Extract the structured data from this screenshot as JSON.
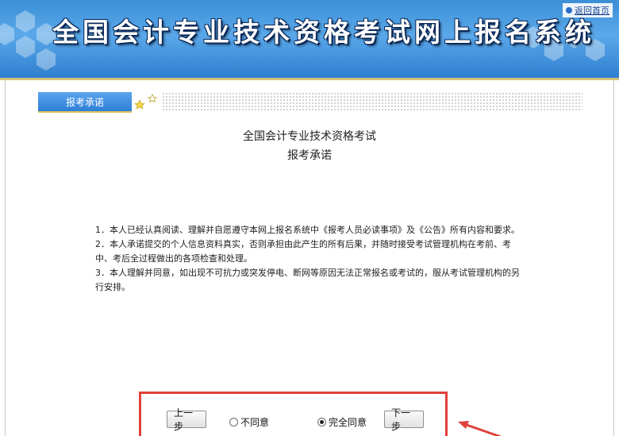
{
  "header": {
    "title": "全国会计专业技术资格考试网上报名系统",
    "home_link": "返回首页"
  },
  "tab": {
    "label": "报考承诺"
  },
  "document": {
    "title_line1": "全国会计专业技术资格考试",
    "title_line2": "报考承诺",
    "terms": [
      "1．本人已经认真阅读、理解并自愿遵守本网上报名系统中《报考人员必读事项》及《公告》所有内容和要求。",
      "2．本人承诺提交的个人信息资料真实，否则承担由此产生的所有后果，并随时接受考试管理机构在考前、考中、考后全过程做出的各项检查和处理。",
      "3．本人理解并同意，如出现不可抗力或突发停电、断网等原因无法正常报名或考试的，服从考试管理机构的另行安排。"
    ]
  },
  "actions": {
    "prev_label": "上一步",
    "disagree_label": "不同意",
    "agree_label": "完全同意",
    "next_label": "下一步",
    "selected": "agree"
  },
  "colors": {
    "banner": "#3b8fd6",
    "tab": "#2f7fd6",
    "highlight_border": "#e0413b"
  }
}
